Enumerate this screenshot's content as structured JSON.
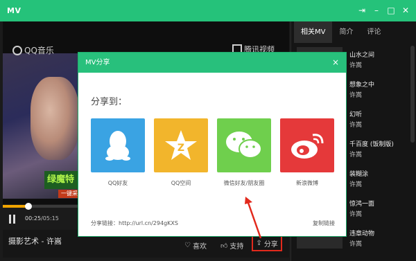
{
  "window": {
    "title": "MV"
  },
  "player": {
    "qq_logo": "QQ音乐",
    "tencent_logo": "腾讯视频",
    "banner_text": "绿魔特",
    "banner_sub": "一键采",
    "current_time": "00:25",
    "total_time": "/05:15",
    "progress": 0.09,
    "song_title": "摄影艺术 - 许嵩",
    "actions": {
      "like": "喜欢",
      "support": "支持",
      "share": "分享"
    }
  },
  "sidebar": {
    "tabs": [
      "相关MV",
      "简介",
      "评论"
    ],
    "items": [
      {
        "title": "山水之间",
        "artist": "许嵩"
      },
      {
        "title": "想象之中",
        "artist": "许嵩"
      },
      {
        "title": "幻听",
        "artist": "许嵩"
      },
      {
        "title": "千百度 (饭制版)",
        "artist": "许嵩"
      },
      {
        "title": "装糊涂",
        "artist": "许嵩"
      },
      {
        "title": "惊鸿一面",
        "artist": "许嵩"
      },
      {
        "title": "违章动物",
        "artist": "许嵩"
      }
    ]
  },
  "dialog": {
    "title": "MV分享",
    "close_icon": "×",
    "heading": "分享到：",
    "options": [
      {
        "label": "QQ好友",
        "icon": "qq-penguin-icon",
        "color": "#3aa3e3"
      },
      {
        "label": "QQ空间",
        "icon": "qzone-star-icon",
        "color": "#f2b52c"
      },
      {
        "label": "微信好友/朋友圈",
        "icon": "wechat-icon",
        "color": "#6fcf4d"
      },
      {
        "label": "新浪微博",
        "icon": "weibo-icon",
        "color": "#e5393a"
      }
    ],
    "link_label": "分享链接：http://url.cn/294gKXS",
    "copy_label": "复制链接"
  },
  "colors": {
    "accent": "#28c07c",
    "highlight": "#e2291c",
    "progress": "#f0a400"
  }
}
